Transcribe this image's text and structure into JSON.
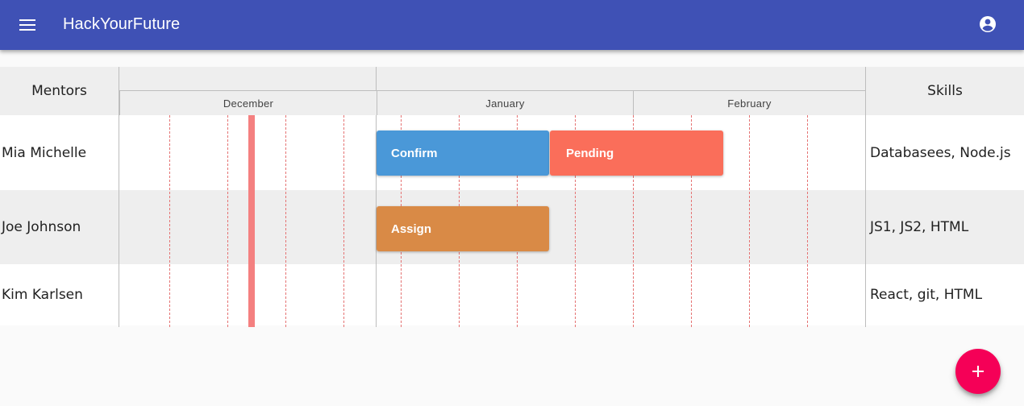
{
  "app": {
    "title": "HackYourFuture"
  },
  "icons": {
    "menu": "menu-icon",
    "account": "account-circle-icon",
    "add": "add-icon"
  },
  "table": {
    "mentors_header": "Mentors",
    "skills_header": "Skills",
    "months": [
      "December",
      "January",
      "February"
    ]
  },
  "rows": [
    {
      "name": "Mia Michelle",
      "skills": "Databasees, Node.js"
    },
    {
      "name": "Joe Johnson",
      "skills": "JS1, JS2, HTML"
    },
    {
      "name": "Kim Karlsen",
      "skills": "React, git, HTML"
    }
  ],
  "bars": {
    "confirm": {
      "label": "Confirm",
      "color": "#4a98d8"
    },
    "pending": {
      "label": "Pending",
      "color": "#fa6e5a"
    },
    "assign": {
      "label": "Assign",
      "color": "#d98a46"
    }
  },
  "colors": {
    "appbar": "#3f51b5",
    "fab": "#f50057",
    "today_marker": "#f48080",
    "row_alt": "#eeeeee"
  }
}
